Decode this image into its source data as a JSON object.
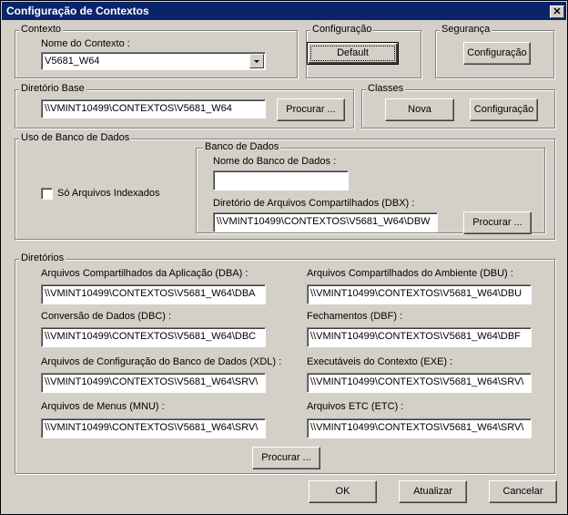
{
  "window": {
    "title": "Configuração de Contextos",
    "close_glyph": "✕"
  },
  "contexto": {
    "legend": "Contexto",
    "name_label": "Nome do Contexto :",
    "name_value": "V5681_W64"
  },
  "configuracao": {
    "legend": "Configuração",
    "default_label": "Default"
  },
  "seguranca": {
    "legend": "Segurança",
    "config_label": "Configuração"
  },
  "diretorio_base": {
    "legend": "Diretório Base",
    "value": "\\\\VMINT10499\\CONTEXTOS\\V5681_W64",
    "browse_label": "Procurar ..."
  },
  "classes": {
    "legend": "Classes",
    "nova_label": "Nova",
    "config_label": "Configuração"
  },
  "uso_banco": {
    "legend": "Uso de Banco de Dados",
    "checkbox_label": "Só Arquivos Indexados",
    "checkbox_checked": false,
    "banco": {
      "legend": "Banco de Dados",
      "name_label": "Nome do Banco de Dados :",
      "name_value": "",
      "dbx_label": "Diretório de Arquivos Compartilhados (DBX) :",
      "dbx_value": "\\\\VMINT10499\\CONTEXTOS\\V5681_W64\\DBW",
      "browse_label": "Procurar ..."
    }
  },
  "diretorios": {
    "legend": "Diretórios",
    "dba_label": "Arquivos Compartilhados da Aplicação (DBA) :",
    "dba_value": "\\\\VMINT10499\\CONTEXTOS\\V5681_W64\\DBA",
    "dbu_label": "Arquivos Compartilhados do Ambiente (DBU) :",
    "dbu_value": "\\\\VMINT10499\\CONTEXTOS\\V5681_W64\\DBU",
    "dbc_label": "Conversão de Dados (DBC) :",
    "dbc_value": "\\\\VMINT10499\\CONTEXTOS\\V5681_W64\\DBC",
    "dbf_label": "Fechamentos (DBF) :",
    "dbf_value": "\\\\VMINT10499\\CONTEXTOS\\V5681_W64\\DBF",
    "xdl_label": "Arquivos de Configuração do Banco de Dados (XDL) :",
    "xdl_value": "\\\\VMINT10499\\CONTEXTOS\\V5681_W64\\SRV\\",
    "exe_label": "Executáveis do Contexto (EXE) :",
    "exe_value": "\\\\VMINT10499\\CONTEXTOS\\V5681_W64\\SRV\\",
    "mnu_label": "Arquivos de Menus (MNU) :",
    "mnu_value": "\\\\VMINT10499\\CONTEXTOS\\V5681_W64\\SRV\\",
    "etc_label": "Arquivos ETC (ETC) :",
    "etc_value": "\\\\VMINT10499\\CONTEXTOS\\V5681_W64\\SRV\\",
    "browse_label": "Procurar ..."
  },
  "footer": {
    "ok_label": "OK",
    "atualizar_label": "Atualizar",
    "cancelar_label": "Cancelar"
  }
}
